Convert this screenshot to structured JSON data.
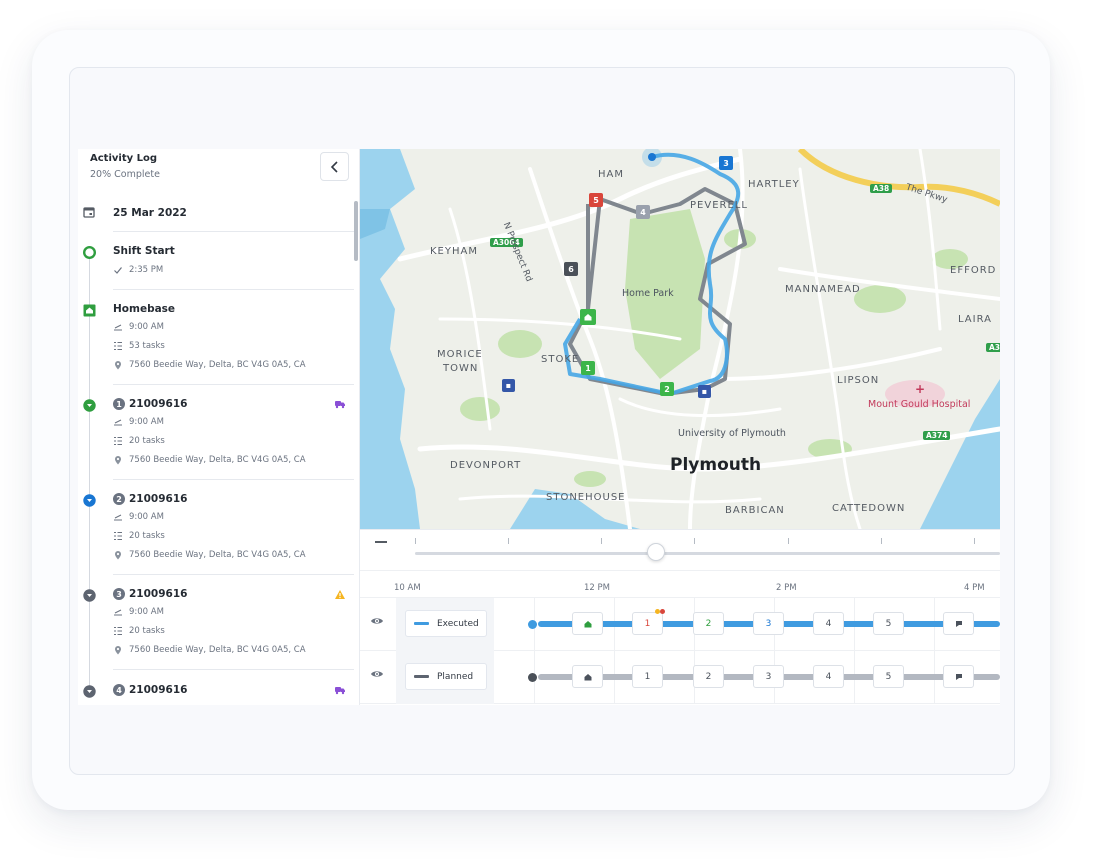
{
  "sidebar": {
    "title": "Activity Log",
    "subtitle": "20% Complete",
    "date": "25 Mar 2022",
    "entries": [
      {
        "title": "Shift Start",
        "time": "2:35 PM"
      },
      {
        "title": "Homebase",
        "time": "9:00 AM",
        "tasks": "53 tasks",
        "address": "7560 Beedie Way, Delta, BC V4G 0A5, CA"
      },
      {
        "num": "1",
        "title": "21009616",
        "time": "9:00 AM",
        "tasks": "20 tasks",
        "address": "7560 Beedie Way, Delta, BC V4G 0A5, CA"
      },
      {
        "num": "2",
        "title": "21009616",
        "time": "9:00 AM",
        "tasks": "20 tasks",
        "address": "7560 Beedie Way, Delta, BC V4G 0A5, CA"
      },
      {
        "num": "3",
        "title": "21009616",
        "time": "9:00 AM",
        "tasks": "20 tasks",
        "address": "7560 Beedie Way, Delta, BC V4G 0A5, CA"
      },
      {
        "num": "4",
        "title": "21009616"
      }
    ]
  },
  "map": {
    "labels": [
      "HAM",
      "HARTLEY",
      "PEVERELL",
      "KEYHAM",
      "EFFORD",
      "MANNAMEAD",
      "LAIRA",
      "MORICE",
      "TOWN",
      "STOKE",
      "LIPSON",
      "DEVONPORT",
      "STONEHOUSE",
      "BARBICAN",
      "CATTEDOWN"
    ],
    "city": "Plymouth",
    "poi_park": "Home Park",
    "poi_uni": "University of Plymouth",
    "poi_hospital": "Mount Gould Hospital",
    "road_tags": [
      "A3064",
      "A38",
      "A374",
      "A3"
    ],
    "road_names": [
      "N Prospect Rd",
      "The Pkwy"
    ],
    "pins": [
      "1",
      "2",
      "3",
      "4",
      "5",
      "6"
    ]
  },
  "timeline": {
    "hours": [
      "10 AM",
      "12 PM",
      "2 PM",
      "4 PM"
    ],
    "tracks": [
      {
        "name": "Executed",
        "stops": [
          "1",
          "2",
          "3",
          "4",
          "5"
        ]
      },
      {
        "name": "Planned",
        "stops": [
          "1",
          "2",
          "3",
          "4",
          "5"
        ]
      }
    ]
  },
  "colors": {
    "executed": "#3f9be0",
    "planned": "#9aa1ad",
    "green": "#2f9e3f",
    "blue": "#1976d2",
    "red": "#d9463b",
    "warning": "#f5b521",
    "purple": "#8a4fd6"
  }
}
